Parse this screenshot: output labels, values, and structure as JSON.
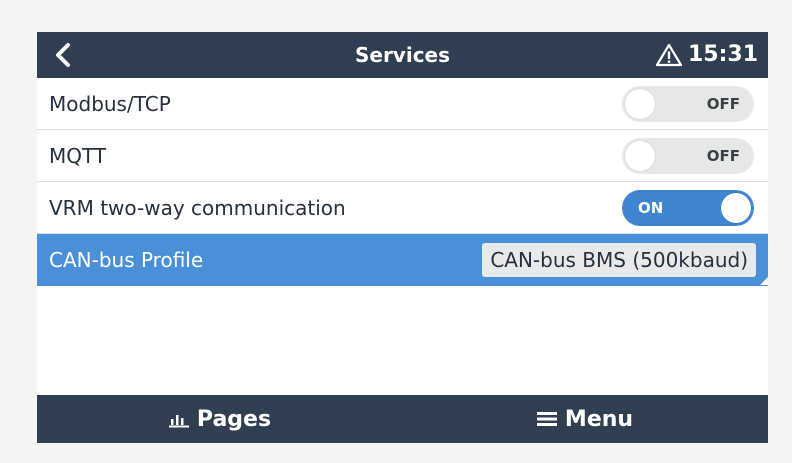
{
  "header": {
    "title": "Services",
    "time": "15:31",
    "back_icon": "chevron-left-icon",
    "alert_icon": "warning-icon"
  },
  "items": [
    {
      "label": "Modbus/TCP",
      "control": "switch",
      "state": "off",
      "state_label": "OFF"
    },
    {
      "label": "MQTT",
      "control": "switch",
      "state": "off",
      "state_label": "OFF"
    },
    {
      "label": "VRM two-way communication",
      "control": "switch",
      "state": "on",
      "state_label": "ON"
    },
    {
      "label": "CAN-bus Profile",
      "control": "value",
      "value": "CAN-bus BMS (500kbaud)",
      "selected": true
    }
  ],
  "footer": {
    "pages_label": "Pages",
    "pages_icon": "bar-chart-icon",
    "menu_label": "Menu",
    "menu_icon": "hamburger-menu-icon"
  },
  "colors": {
    "bar": "#2f3e50",
    "selected": "#4a90d9",
    "switch_on": "#3f86cf",
    "switch_off": "#e6e7e7"
  }
}
